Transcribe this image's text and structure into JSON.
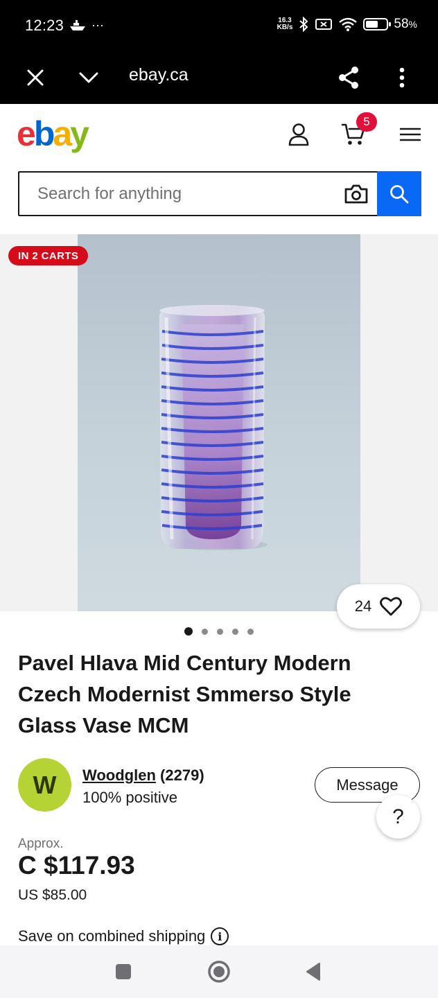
{
  "status_bar": {
    "time": "12:23",
    "dots": "···",
    "net_speed_value": "16.3",
    "net_speed_unit": "KB/s",
    "battery_percent": "58",
    "battery_suffix": "%",
    "icons": [
      "boat-icon",
      "bluetooth-icon",
      "no-sim-icon",
      "wifi-icon",
      "battery-icon"
    ]
  },
  "browser": {
    "url": "ebay.ca",
    "icons": [
      "close-icon",
      "chevron-down-icon",
      "share-icon",
      "more-vert-icon"
    ]
  },
  "header": {
    "logo": {
      "e": "e",
      "b": "b",
      "a": "a",
      "y": "y"
    },
    "logo_colors": [
      "#e53238",
      "#0064d2",
      "#f5af02",
      "#86b817"
    ],
    "cart_count": "5",
    "icons": [
      "account-icon",
      "cart-icon",
      "menu-icon"
    ]
  },
  "search": {
    "placeholder": "Search for anything",
    "value": "",
    "accent": "#0968f6"
  },
  "gallery": {
    "badge": "IN 2 CARTS",
    "watch_count": "24",
    "image_count": 5,
    "active_index": 0
  },
  "listing": {
    "title": "Pavel Hlava Mid Century Modern Czech Modernist Smmerso Style Glass Vase MCM"
  },
  "seller": {
    "initial": "W",
    "name": "Woodglen",
    "feedback_count": "(2279)",
    "positive": "100% positive",
    "message_label": "Message",
    "help_label": "?"
  },
  "price": {
    "approx_label": "Approx.",
    "amount": "C $117.93",
    "usd": "US $85.00"
  },
  "shipping": {
    "text": "Save on combined shipping",
    "info_glyph": "i"
  },
  "nav": {
    "icons": [
      "recents-square-icon",
      "home-circle-icon",
      "back-triangle-icon"
    ]
  }
}
